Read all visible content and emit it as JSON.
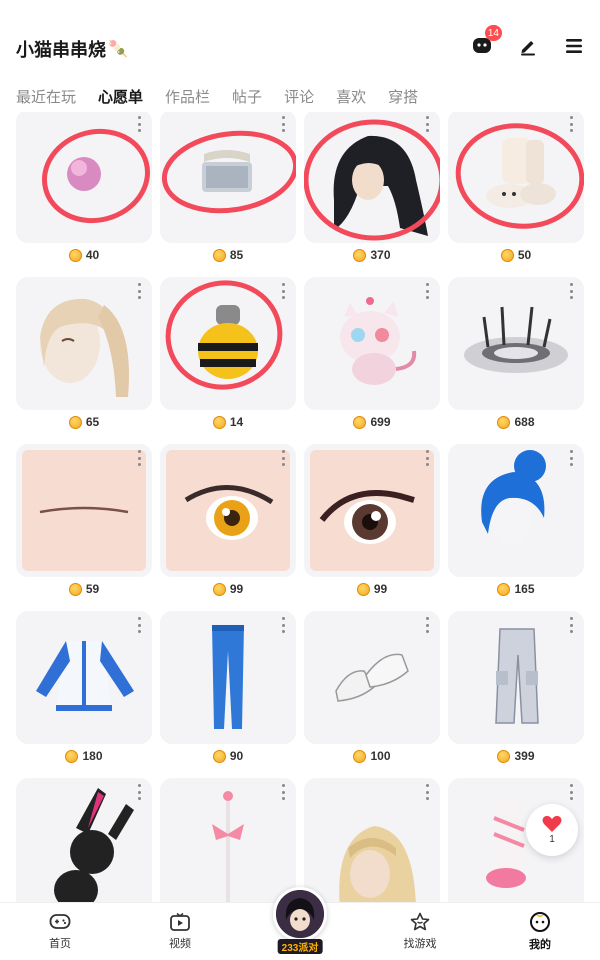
{
  "header": {
    "title": "小猫串串烧",
    "title_emoji": "🍡",
    "message_badge": "14",
    "icons": [
      "chat-bubble-icon",
      "edit-pencil-icon",
      "menu-icon"
    ]
  },
  "tabs": [
    "最近在玩",
    "心愿单",
    "作品栏",
    "帖子",
    "评论",
    "喜欢",
    "穿搭"
  ],
  "active_tab": "心愿单",
  "grid": {
    "items": [
      {
        "name": "pink-orb",
        "price": "40"
      },
      {
        "name": "silver-band",
        "price": "85"
      },
      {
        "name": "black-long-hair",
        "price": "370"
      },
      {
        "name": "bunny-slippers",
        "price": "50"
      },
      {
        "name": "blonde-ponytail-hair",
        "price": "65"
      },
      {
        "name": "bee-pet",
        "price": "14"
      },
      {
        "name": "pink-cat-creature",
        "price": "699"
      },
      {
        "name": "spike-halo-effect",
        "price": "688"
      },
      {
        "name": "thin-brow-face",
        "price": "59"
      },
      {
        "name": "amber-eye",
        "price": "99"
      },
      {
        "name": "dark-eye",
        "price": "99"
      },
      {
        "name": "blue-bun-hair",
        "price": "165"
      },
      {
        "name": "blue-white-jacket",
        "price": "180"
      },
      {
        "name": "blue-pants",
        "price": "90"
      },
      {
        "name": "white-sneakers",
        "price": "100"
      },
      {
        "name": "cargo-pants",
        "price": "399"
      },
      {
        "name": "black-bunny-plush",
        "price": ""
      },
      {
        "name": "ribbon-wand",
        "price": ""
      },
      {
        "name": "blonde-braid-hair",
        "price": ""
      },
      {
        "name": "pink-leg-warmers",
        "price": ""
      }
    ]
  },
  "floating_like": {
    "count": "1"
  },
  "bottom_nav": {
    "items": [
      {
        "label": "首页",
        "icon": "gamepad-icon"
      },
      {
        "label": "视频",
        "icon": "video-play-icon"
      },
      {
        "label": "233派对",
        "icon": "party-avatar-icon"
      },
      {
        "label": "找游戏",
        "icon": "star-search-icon"
      },
      {
        "label": "我的",
        "icon": "face-icon"
      }
    ],
    "active": "我的"
  },
  "colors": {
    "accent": "#ff7a1a",
    "badge": "#ff4d4f",
    "annotation_circle": "#f24a5a",
    "card_bg": "#f4f4f7"
  }
}
